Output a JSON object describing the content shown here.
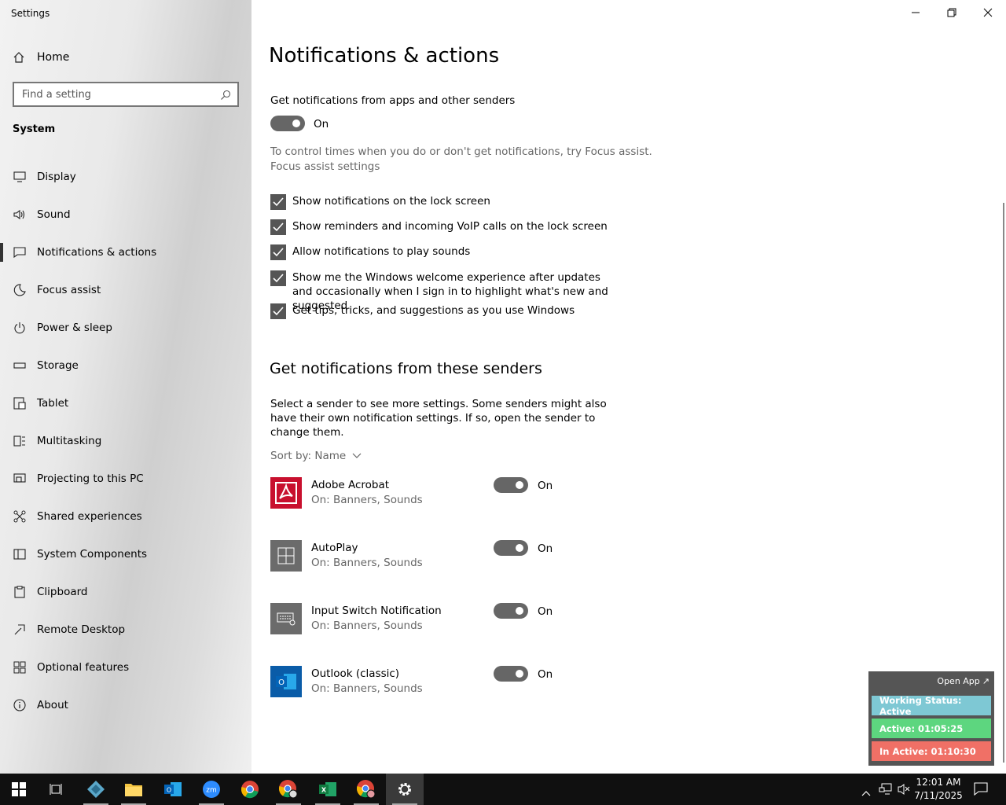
{
  "window": {
    "title": "Settings"
  },
  "sidebar": {
    "home_label": "Home",
    "search_placeholder": "Find a setting",
    "section": "System",
    "items": [
      {
        "label": "Display",
        "icon": "monitor-icon"
      },
      {
        "label": "Sound",
        "icon": "speaker-icon"
      },
      {
        "label": "Notifications & actions",
        "icon": "message-icon",
        "active": true
      },
      {
        "label": "Focus assist",
        "icon": "moon-icon"
      },
      {
        "label": "Power & sleep",
        "icon": "power-icon"
      },
      {
        "label": "Storage",
        "icon": "storage-icon"
      },
      {
        "label": "Tablet",
        "icon": "tablet-icon"
      },
      {
        "label": "Multitasking",
        "icon": "multitasking-icon"
      },
      {
        "label": "Projecting to this PC",
        "icon": "projector-icon"
      },
      {
        "label": "Shared experiences",
        "icon": "shared-icon"
      },
      {
        "label": "System Components",
        "icon": "components-icon"
      },
      {
        "label": "Clipboard",
        "icon": "clipboard-icon"
      },
      {
        "label": "Remote Desktop",
        "icon": "remote-icon"
      },
      {
        "label": "Optional features",
        "icon": "grid-icon"
      },
      {
        "label": "About",
        "icon": "info-icon"
      }
    ]
  },
  "main": {
    "title": "Notifications & actions",
    "get_notifications_label": "Get notifications from apps and other senders",
    "main_toggle_state": "On",
    "focus_text": "To control times when you do or don't get notifications, try Focus assist.",
    "focus_link": "Focus assist settings",
    "checkboxes": [
      {
        "label": "Show notifications on the lock screen",
        "checked": true
      },
      {
        "label": "Show reminders and incoming VoIP calls on the lock screen",
        "checked": true
      },
      {
        "label": "Allow notifications to play sounds",
        "checked": true
      },
      {
        "label": "Show me the Windows welcome experience after updates and occasionally when I sign in to highlight what's new and suggested",
        "checked": true
      },
      {
        "label": "Get tips, tricks, and suggestions as you use Windows",
        "checked": true
      }
    ],
    "senders_heading": "Get notifications from these senders",
    "senders_desc": "Select a sender to see more settings. Some senders might also have their own notification settings. If so, open the sender to change them.",
    "sort_label": "Sort by: Name",
    "senders": [
      {
        "name": "Adobe Acrobat",
        "sub": "On: Banners, Sounds",
        "state": "On",
        "icon": "acrobat-icon",
        "color": "#c8102e"
      },
      {
        "name": "AutoPlay",
        "sub": "On: Banners, Sounds",
        "state": "On",
        "icon": "autoplay-icon",
        "color": "#6b6b6b"
      },
      {
        "name": "Input Switch Notification",
        "sub": "On: Banners, Sounds",
        "state": "On",
        "icon": "keyboard-icon",
        "color": "#6b6b6b"
      },
      {
        "name": "Outlook (classic)",
        "sub": "On: Banners, Sounds",
        "state": "On",
        "icon": "outlook-icon",
        "color": "#0a5ca8"
      }
    ]
  },
  "widget": {
    "open_label": "Open App",
    "status": "Working Status: Active",
    "active": "Active: 01:05:25",
    "inactive": "In Active: 01:10:30",
    "status_color": "#7ec8d4",
    "active_color": "#5dd67f",
    "inactive_color": "#f07066"
  },
  "taskbar": {
    "time": "12:01 AM",
    "date": "7/11/2025"
  }
}
